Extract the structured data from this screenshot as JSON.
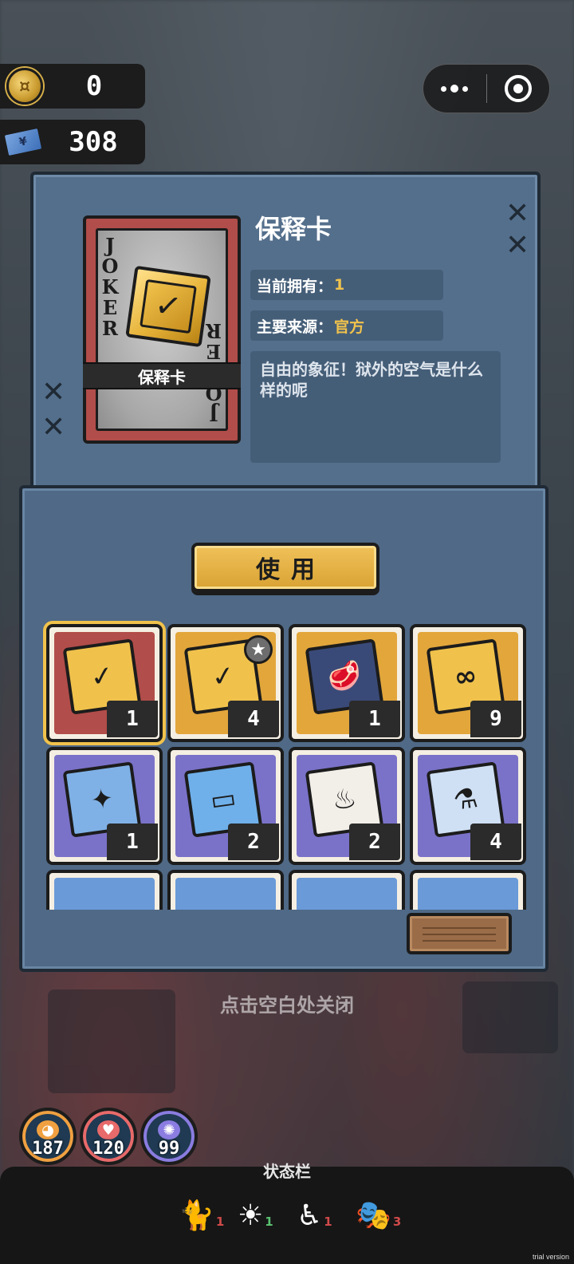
{
  "currency": {
    "coins": "0",
    "tickets": "308"
  },
  "capsule": {
    "more_icon": "more-dots-icon",
    "close_icon": "target-close-icon"
  },
  "item_detail": {
    "card_vertical_text": "JOKER",
    "card_label": "保释卡",
    "title": "保释卡",
    "owned_label": "当前拥有：",
    "owned_value": "1",
    "source_label": "主要来源：",
    "source_value": "官方",
    "description": "自由的象征！狱外的空气是什么样的呢"
  },
  "use_button": "使用",
  "inventory": [
    {
      "name": "bail-card",
      "count": "1",
      "bg": "#b14d4a",
      "glyph": "✓",
      "color": "#f0c24c",
      "selected": true
    },
    {
      "name": "bail-card-star",
      "count": "4",
      "bg": "#e2a63b",
      "glyph": "✓",
      "color": "#f0c24c",
      "badge": "★"
    },
    {
      "name": "steak-card",
      "count": "1",
      "bg": "#e2a63b",
      "glyph": "🥩",
      "color": "#3a4a78"
    },
    {
      "name": "ribbon-card",
      "count": "9",
      "bg": "#e2a63b",
      "glyph": "∞",
      "color": "#f0c24c"
    },
    {
      "name": "blue-ticket",
      "count": "1",
      "bg": "#7a72c8",
      "glyph": "✦",
      "color": "#7fb1e6"
    },
    {
      "name": "sunglasses-id",
      "count": "2",
      "bg": "#7a72c8",
      "glyph": "▭",
      "color": "#6fb0ea"
    },
    {
      "name": "flame-box",
      "count": "2",
      "bg": "#7a72c8",
      "glyph": "♨",
      "color": "#f2eee8"
    },
    {
      "name": "medicine-kit",
      "count": "4",
      "bg": "#7a72c8",
      "glyph": "⚗",
      "color": "#cfe0f4"
    },
    {
      "name": "partial-item-1",
      "count": "",
      "bg": "#6a9ad8",
      "glyph": "",
      "color": "#6a9ad8"
    },
    {
      "name": "partial-item-2",
      "count": "",
      "bg": "#6a9ad8",
      "glyph": "",
      "color": "#6a9ad8"
    },
    {
      "name": "partial-item-3",
      "count": "",
      "bg": "#6a9ad8",
      "glyph": "",
      "color": "#6a9ad8"
    },
    {
      "name": "partial-item-4",
      "count": "",
      "bg": "#6a9ad8",
      "glyph": "",
      "color": "#6a9ad8"
    }
  ],
  "close_hint": "点击空白处关闭",
  "stats": [
    {
      "name": "hunger",
      "icon": "pacman-icon",
      "glyph": "◕",
      "value": "187",
      "ring": "#f0a040"
    },
    {
      "name": "health",
      "icon": "heart-icon",
      "glyph": "♥",
      "value": "120",
      "ring": "#e86a6a"
    },
    {
      "name": "sanity",
      "icon": "brain-icon",
      "glyph": "✺",
      "value": "99",
      "ring": "#8a7ce0"
    }
  ],
  "status_bar": {
    "title": "状态栏",
    "items": [
      {
        "name": "cat",
        "icon": "cat-status-icon",
        "glyph": "🐈",
        "count": "1",
        "color": "#d04a4a"
      },
      {
        "name": "alarm",
        "icon": "alarm-status-icon",
        "glyph": "☀",
        "count": "1",
        "color": "#5ac070"
      },
      {
        "name": "tired",
        "icon": "tired-status-icon",
        "glyph": "♿",
        "count": "1",
        "color": "#d04a4a"
      },
      {
        "name": "mask",
        "icon": "mask-status-icon",
        "glyph": "🎭",
        "count": "3",
        "color": "#d04a4a"
      }
    ]
  },
  "trial_text": "trial version"
}
